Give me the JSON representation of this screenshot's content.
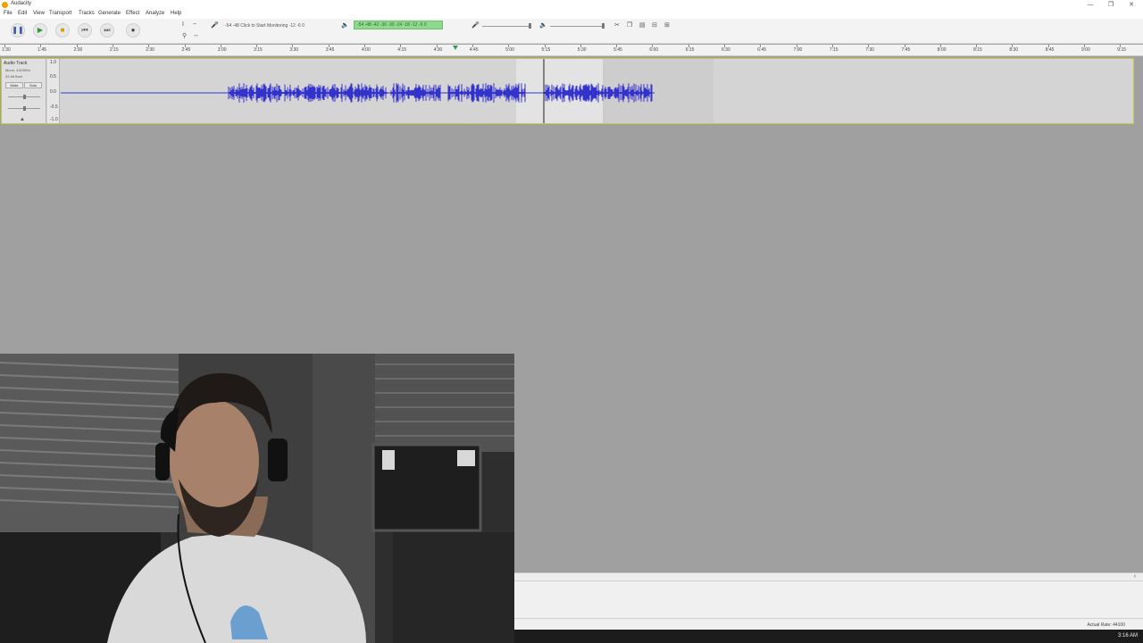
{
  "window": {
    "title": "Audacity",
    "minimize_glyph": "—",
    "maximize_glyph": "❐",
    "close_glyph": "✕"
  },
  "menu": {
    "items": [
      "File",
      "Edit",
      "View",
      "Transport",
      "Tracks",
      "Generate",
      "Effect",
      "Analyze",
      "Help"
    ]
  },
  "toolbar": {
    "pause_icon": "pause-icon",
    "play_icon": "play-icon",
    "stop_icon": "stop-icon",
    "skip_start_icon": "skip-start-icon",
    "skip_end_icon": "skip-end-icon",
    "record_icon": "record-icon",
    "record_meter_text": "-54   -48   Click to Start Monitoring   -12   -6   0",
    "playback_meter_text": "-54  -48  -42  -36  -30  -24  -18  -12  -6  0",
    "colors": {
      "play": "#2c9a2c",
      "stop": "#d4a200",
      "pause": "#3a5aa8",
      "meter": "#8fd98f"
    }
  },
  "timeline": {
    "ticks": [
      "1:30",
      "1:45",
      "2:00",
      "2:15",
      "2:30",
      "2:45",
      "3:00",
      "3:15",
      "3:30",
      "3:45",
      "4:00",
      "4:15",
      "4:30",
      "4:45",
      "5:00",
      "5:15",
      "5:30",
      "5:45",
      "6:00",
      "6:15",
      "6:30",
      "6:45",
      "7:00",
      "7:15",
      "7:30",
      "7:45",
      "8:00",
      "8:15",
      "8:30",
      "8:45",
      "9:00",
      "9:15"
    ]
  },
  "track": {
    "name": "Audio Track",
    "format": "Mono, 44100Hz",
    "bit_depth": "32-bit float",
    "mute_label": "Mute",
    "solo_label": "Solo",
    "collapse_glyph": "▲",
    "vruler": [
      "1.0",
      "0.5",
      "0.0",
      "-0.5",
      "-1.0"
    ],
    "waveform_color": "#3333cc"
  },
  "status": {
    "actual_rate": "Actual Rate: 44100"
  },
  "taskbar": {
    "clock": "3:16 AM"
  },
  "webcam": {
    "description_icon": "webcam-feed"
  }
}
